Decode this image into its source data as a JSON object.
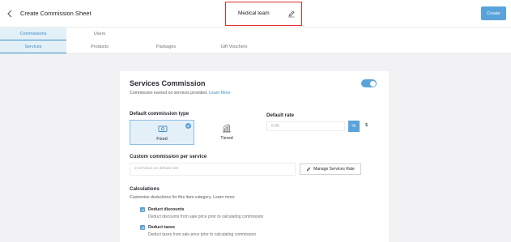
{
  "header": {
    "title": "Create Commission Sheet",
    "sheet_name": "Medical team",
    "create_label": "Create"
  },
  "tabs_primary": [
    {
      "label": "Commissions",
      "active": true
    },
    {
      "label": "Users",
      "active": false
    }
  ],
  "tabs_secondary": [
    {
      "label": "Services",
      "active": true
    },
    {
      "label": "Products",
      "active": false
    },
    {
      "label": "Packages",
      "active": false
    },
    {
      "label": "Gift Vouchers",
      "active": false
    }
  ],
  "section": {
    "title": "Services Commission",
    "subtitle": "Commission earned on services provided.",
    "learn_more": "Learn More",
    "enabled": true
  },
  "commission_type": {
    "label": "Default commission type",
    "options": [
      {
        "label": "Fixed",
        "selected": true,
        "icon": "cash-icon"
      },
      {
        "label": "Tiered",
        "selected": false,
        "icon": "bar-chart-icon"
      }
    ]
  },
  "default_rate": {
    "label": "Default rate",
    "placeholder": "0.00",
    "percent_label": "%",
    "dollar_label": "$"
  },
  "custom": {
    "label": "Custom commission per service",
    "input_text": "3 Services on default rate",
    "manage_label": "Manage Services Rate"
  },
  "calculations": {
    "label": "Calculations",
    "subtitle": "Customise deductions for this item category.",
    "learn_more": "Learn more",
    "items": [
      {
        "title": "Deduct discounts",
        "desc": "Deduct discounts from sale price prior to calculating commission",
        "checked": true
      },
      {
        "title": "Deduct taxes",
        "desc": "Deduct taxes from sale price prior to calculating commission",
        "checked": true
      }
    ]
  },
  "colors": {
    "accent": "#5aa3da",
    "highlight_border": "#e03030"
  }
}
